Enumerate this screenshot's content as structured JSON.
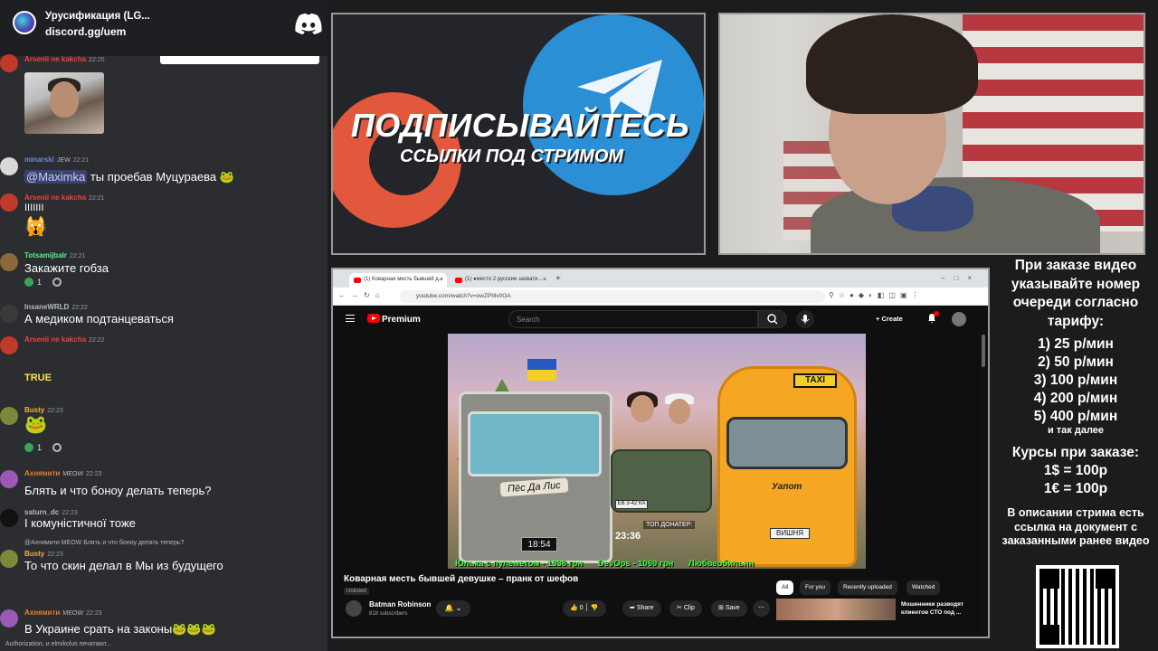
{
  "discord": {
    "server_name": "Урусификация (LG...",
    "invite": "discord.gg/uem",
    "messages": [
      {
        "user": "Arsenii ne kakcha",
        "badges": "",
        "time": "22:20",
        "text": "",
        "user_color": "#f23f43"
      },
      {
        "user": "minarski",
        "badges": "JEW",
        "time": "22:21",
        "mention": "@Maximka",
        "text": " ты проебав Муцураева",
        "emoji": "🐸",
        "user_color": "#7289da"
      },
      {
        "user": "Arsenii ne kakcha",
        "badges": "",
        "time": "22:21",
        "text": "IIIIIII",
        "emoji": "🙀",
        "user_color": "#f23f43"
      },
      {
        "user": "Totsamijbalr",
        "badges": "",
        "time": "22:21",
        "text": "Закажите гобза",
        "reaction_count": "1",
        "user_color": "#57f287"
      },
      {
        "user": "InsaneWRLD",
        "badges": "",
        "time": "22:22",
        "text": "А медиком подтанцеваться",
        "user_color": "#b5bac1"
      },
      {
        "user": "Arsenii ne kakcha",
        "badges": "",
        "time": "22:22",
        "text": "",
        "emoji_label": "TRUE",
        "user_color": "#f23f43"
      },
      {
        "user": "Busty",
        "badges": "",
        "time": "22:23",
        "text": "",
        "emoji": "🐸",
        "reaction_count": "1",
        "user_color": "#f0b232"
      },
      {
        "user": "Ахнямити",
        "badges": "MEOW",
        "time": "22:23",
        "text": "Блять и что боноу делать теперь?",
        "user_color": "#e67e22"
      },
      {
        "user": "saturn_dc",
        "badges": "",
        "time": "22:23",
        "text": "І комуністичної тоже",
        "user_color": "#b5bac1"
      },
      {
        "user": "Busty",
        "badges": "",
        "time": "22:23",
        "reply": "@Ахнямити MEOW Блять и что боноу делать теперь?",
        "text": "То что скин делал в Мы из будущего",
        "user_color": "#f0b232"
      },
      {
        "user": "Ахнямити",
        "badges": "MEOW",
        "time": "22:23",
        "text": "В Украине срать на законы",
        "emoji": "🐸🐸🐸",
        "user_color": "#e67e22"
      }
    ],
    "typing": "Authorization, и elmikolus печатают..."
  },
  "promo": {
    "title": "ПОДПИСЫВАЙТЕСЬ",
    "subtitle": "ССЫЛКИ ПОД СТРИМОМ"
  },
  "browser": {
    "tabs": [
      {
        "label": "(1) Коварная месть бывшей д..."
      },
      {
        "label": "(1) ●место 2 русские захвати..."
      }
    ],
    "url": "youtube.com/watch?v=owZPIIlv0GA",
    "youtube": {
      "brand": "Premium",
      "search_placeholder": "Search",
      "create_label": "Create",
      "notification_count": "1",
      "timer": "23:36",
      "donor_label": "ТОП ДОНАТЕР:",
      "clock": "18:54",
      "sticker": "Пёс Да Лис",
      "taxi_sign": "TAXI",
      "taxi_brand": "Уапот",
      "taxi_plate": "ВИШНЯ",
      "niva_plate": "ЕВ 3-42 КА",
      "ticker": [
        "Юлька с пулеметом - 1338 грн",
        "DevOps - 1069 грн",
        "Любвеобильнн"
      ],
      "video_title": "Коварная месть бывшей девушке – пранк от шефов",
      "unlisted": "Unlisted",
      "channel": "Batman Robinson",
      "subscribers": "818 subscribers",
      "likes": "0",
      "share": "Share",
      "clip": "Clip",
      "save": "Save",
      "chips": [
        "All",
        "For you",
        "Recently uploaded",
        "Watched"
      ],
      "rec_title": "Мошенники разводят клиентов СТО под ..."
    }
  },
  "info": {
    "heading": "При заказе видео указывайте номер очереди согласно тарифу:",
    "tariffs": [
      "1) 25 р/мин",
      "2) 50 р/мин",
      "3) 100 р/мин",
      "4) 200 р/мин",
      "5) 400 р/мин"
    ],
    "tariff_more": "и так далее",
    "rates_heading": "Курсы при заказе:",
    "rates": [
      "1$ = 100р",
      "1€ = 100р"
    ],
    "description": "В описании стрима есть ссылка на документ с заказанными ранее видео"
  },
  "colors": {
    "discord_bg": "#2b2d31",
    "patreon": "#e2583c",
    "telegram": "#2b8fd6",
    "yt_red": "#ff0000",
    "ticker_green": "#3cff3c"
  }
}
